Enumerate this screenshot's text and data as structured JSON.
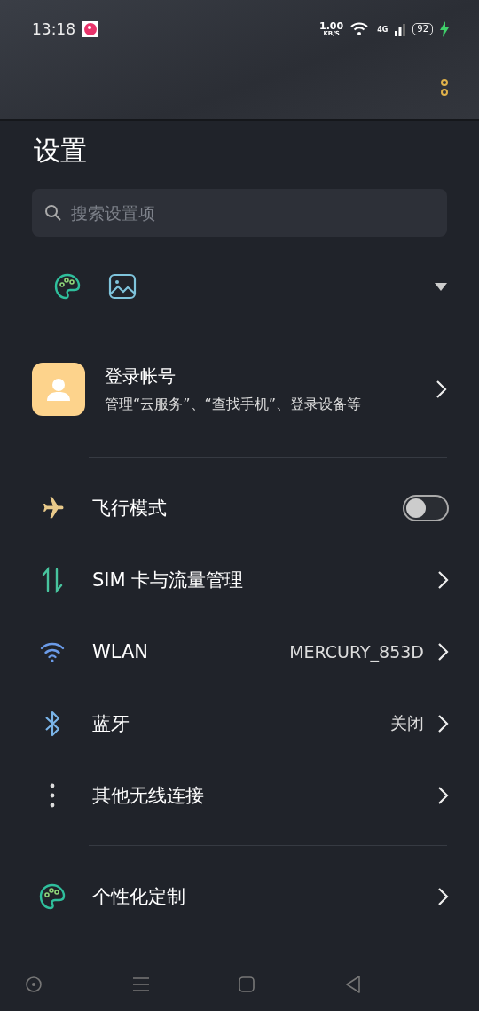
{
  "status_bar": {
    "time": "13:18",
    "speed": "1.00",
    "speed_unit": "KB/S",
    "network": "4G",
    "battery": "92",
    "charging": true
  },
  "title": "设置",
  "search": {
    "placeholder": "搜索设置项"
  },
  "account": {
    "title": "登录帐号",
    "subtitle": "管理“云服务”、“查找手机”、登录设备等"
  },
  "groups": [
    [
      {
        "kind": "toggle",
        "label": "飞行模式",
        "on": false
      },
      {
        "kind": "link",
        "label": "SIM 卡与流量管理"
      },
      {
        "kind": "link",
        "label": "WLAN",
        "value": "MERCURY_853D"
      },
      {
        "kind": "link",
        "label": "蓝牙",
        "value": "关闭"
      },
      {
        "kind": "link",
        "label": "其他无线连接"
      }
    ],
    [
      {
        "kind": "link",
        "label": "个性化定制"
      }
    ]
  ]
}
